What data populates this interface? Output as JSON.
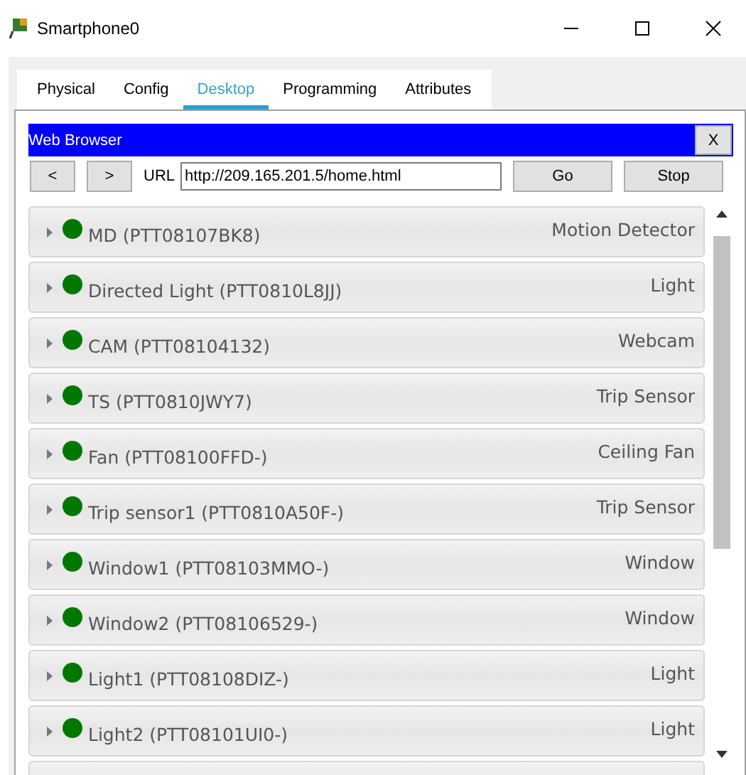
{
  "window": {
    "title": "Smartphone0"
  },
  "tabs": [
    {
      "label": "Physical",
      "selected": false
    },
    {
      "label": "Config",
      "selected": false
    },
    {
      "label": "Desktop",
      "selected": true
    },
    {
      "label": "Programming",
      "selected": false
    },
    {
      "label": "Attributes",
      "selected": false
    }
  ],
  "browser": {
    "title": "Web Browser",
    "close": "X",
    "back": "<",
    "forward": ">",
    "url_label": "URL",
    "url": "http://209.165.201.5/home.html",
    "go": "Go",
    "stop": "Stop"
  },
  "devices": [
    {
      "name": "MD (PTT08107BK8)",
      "type": "Motion Detector",
      "color": "#007800"
    },
    {
      "name": "Directed Light (PTT0810L8JJ)",
      "type": "Light",
      "color": "#007800"
    },
    {
      "name": "CAM (PTT08104132)",
      "type": "Webcam",
      "color": "#007800"
    },
    {
      "name": "TS (PTT0810JWY7)",
      "type": "Trip Sensor",
      "color": "#007800"
    },
    {
      "name": "Fan (PTT08100FFD-)",
      "type": "Ceiling Fan",
      "color": "#007800"
    },
    {
      "name": "Trip sensor1 (PTT0810A50F-)",
      "type": "Trip Sensor",
      "color": "#007800"
    },
    {
      "name": "Window1 (PTT08103MMO-)",
      "type": "Window",
      "color": "#007800"
    },
    {
      "name": "Window2 (PTT08106529-)",
      "type": "Window",
      "color": "#007800"
    },
    {
      "name": "Light1 (PTT08108DIZ-)",
      "type": "Light",
      "color": "#007800"
    },
    {
      "name": "Light2 (PTT08101UI0-)",
      "type": "Light",
      "color": "#007800"
    }
  ]
}
